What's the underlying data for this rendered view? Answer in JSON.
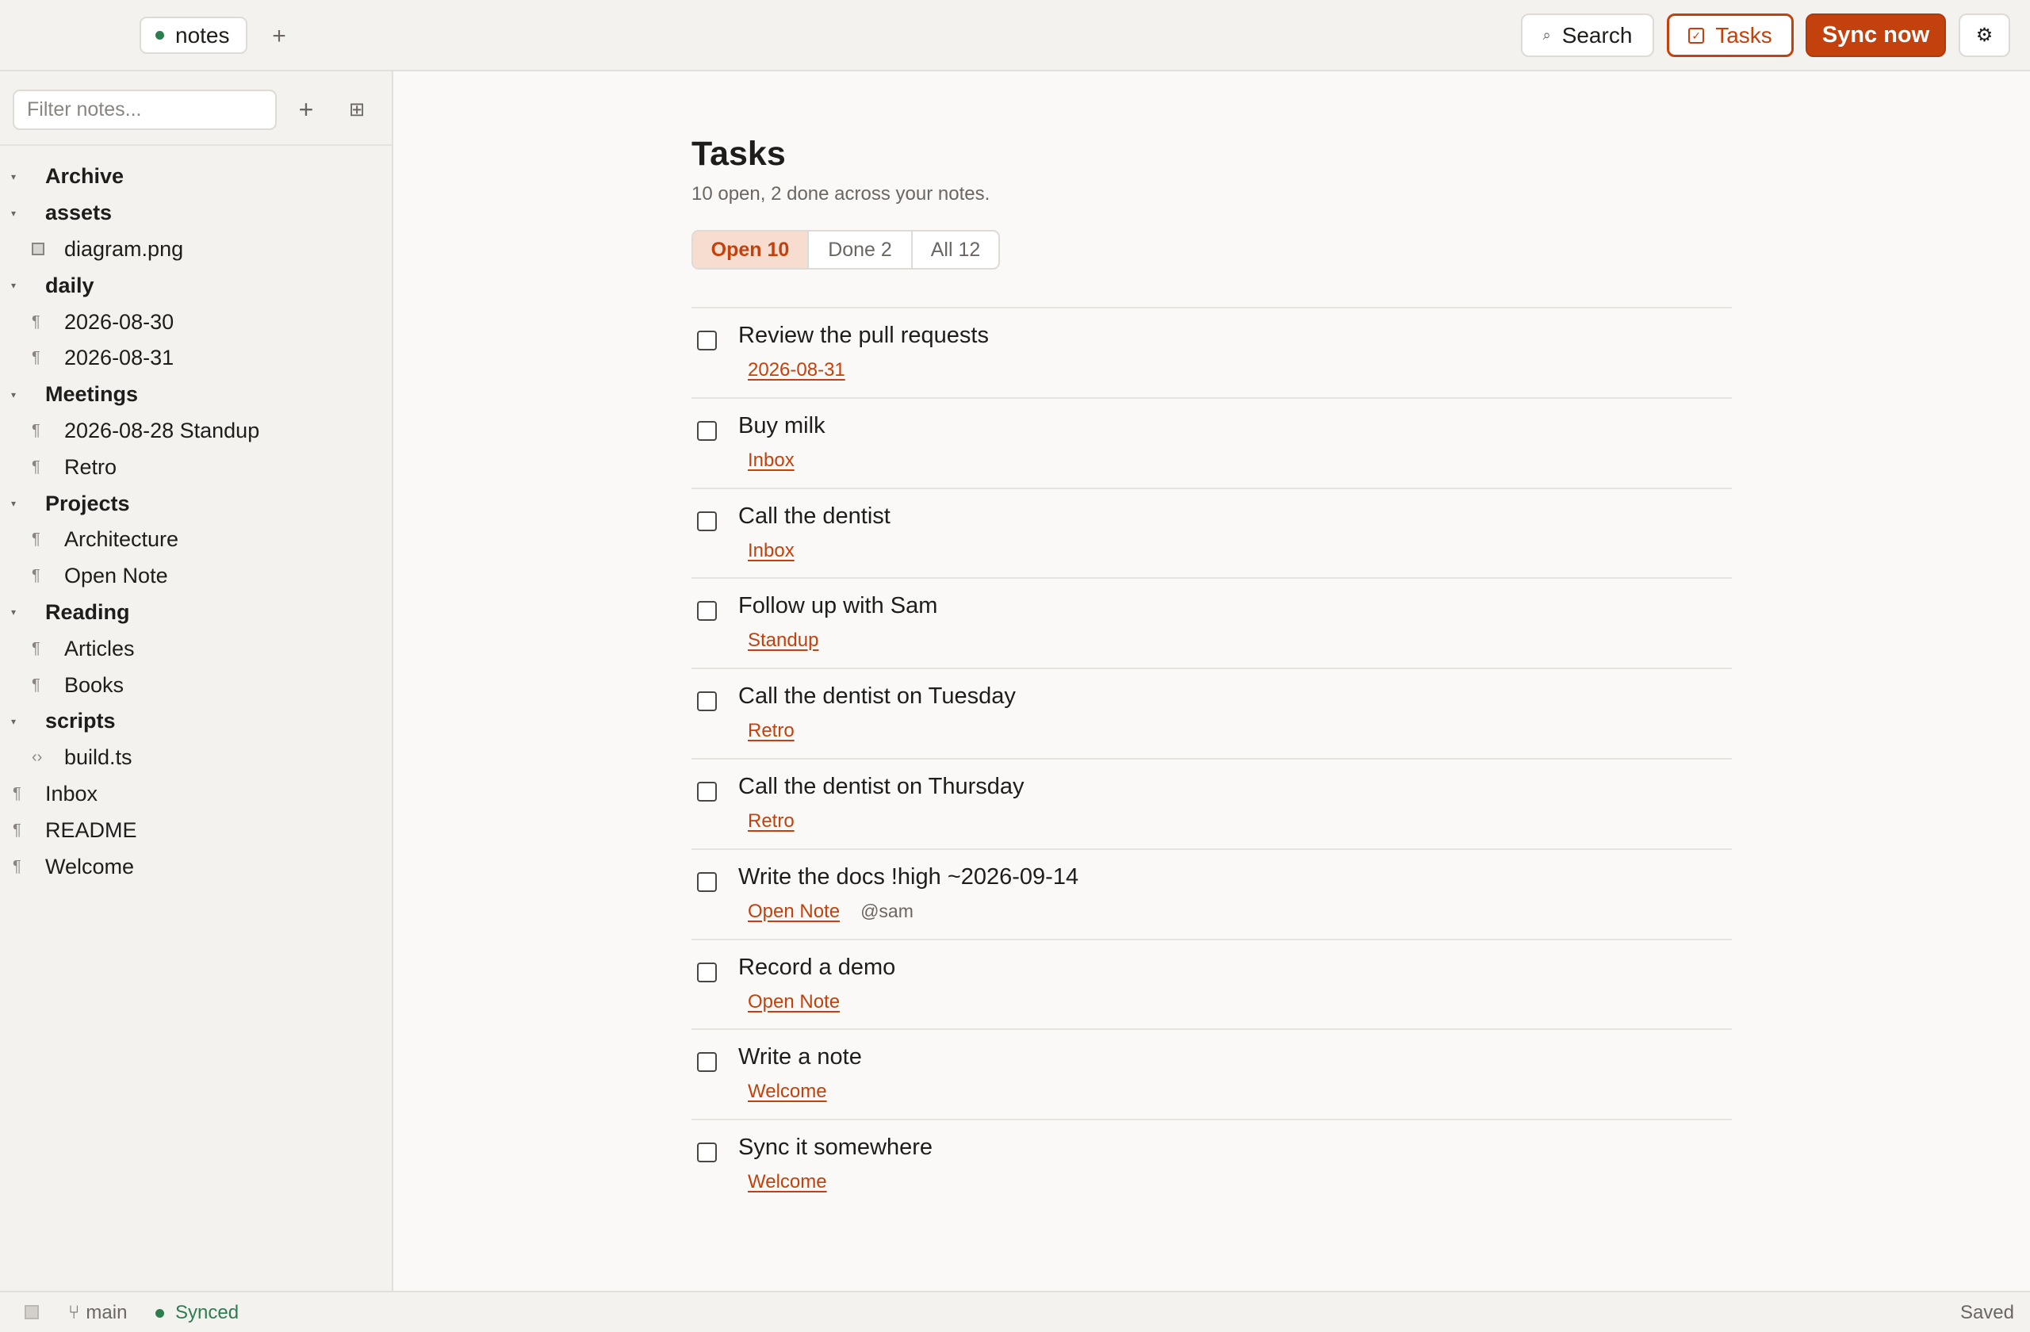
{
  "topbar": {
    "vault_tab": "notes",
    "add_tab": "+",
    "search_label": "Search",
    "search_icon": "⌕",
    "tasks_label": "Tasks",
    "sync_label": "Sync now",
    "settings_icon": "⚙",
    "accent_color": "#c2410c"
  },
  "sidebar": {
    "filter_placeholder": "Filter notes...",
    "add_icon": "+",
    "grid_icon": "⊞",
    "caret": "▾",
    "para_icon": "¶",
    "code_icon": "‹›",
    "tree": [
      {
        "type": "folder",
        "label": "Archive"
      },
      {
        "type": "folder",
        "label": "assets"
      },
      {
        "type": "child-image",
        "label": "diagram.png"
      },
      {
        "type": "folder",
        "label": "daily"
      },
      {
        "type": "child",
        "label": "2026-08-30"
      },
      {
        "type": "child",
        "label": "2026-08-31"
      },
      {
        "type": "folder",
        "label": "Meetings"
      },
      {
        "type": "child",
        "label": "2026-08-28 Standup"
      },
      {
        "type": "child",
        "label": "Retro"
      },
      {
        "type": "folder",
        "label": "Projects"
      },
      {
        "type": "child",
        "label": "Architecture"
      },
      {
        "type": "child",
        "label": "Open Note"
      },
      {
        "type": "folder",
        "label": "Reading"
      },
      {
        "type": "child",
        "label": "Articles"
      },
      {
        "type": "child",
        "label": "Books"
      },
      {
        "type": "folder",
        "label": "scripts"
      },
      {
        "type": "child-code",
        "label": "build.ts"
      },
      {
        "type": "root",
        "label": "Inbox"
      },
      {
        "type": "root",
        "label": "README"
      },
      {
        "type": "root",
        "label": "Welcome"
      }
    ]
  },
  "main": {
    "title": "Tasks",
    "subtitle": "10 open, 2 done across your notes.",
    "filters": {
      "open": "Open 10",
      "done": "Done 2",
      "all": "All 12"
    },
    "tasks": [
      {
        "text": "Review the pull requests",
        "link": "2026-08-31",
        "mention": ""
      },
      {
        "text": "Buy milk",
        "link": "Inbox",
        "mention": ""
      },
      {
        "text": "Call the dentist",
        "link": "Inbox",
        "mention": ""
      },
      {
        "text": "Follow up with Sam",
        "link": "Standup",
        "mention": ""
      },
      {
        "text": "Call the dentist on Tuesday",
        "link": "Retro",
        "mention": ""
      },
      {
        "text": "Call the dentist on Thursday",
        "link": "Retro",
        "mention": ""
      },
      {
        "text": "Write the docs !high ~2026-09-14",
        "link": "Open Note",
        "mention": "@sam"
      },
      {
        "text": "Record a demo",
        "link": "Open Note",
        "mention": ""
      },
      {
        "text": "Write a note",
        "link": "Welcome",
        "mention": ""
      },
      {
        "text": "Sync it somewhere",
        "link": "Welcome",
        "mention": ""
      }
    ]
  },
  "statusbar": {
    "branch_icon": "⑂",
    "branch": "main",
    "sync_status": "Synced",
    "save_status": "Saved",
    "synced_color": "#2e7d4f"
  }
}
